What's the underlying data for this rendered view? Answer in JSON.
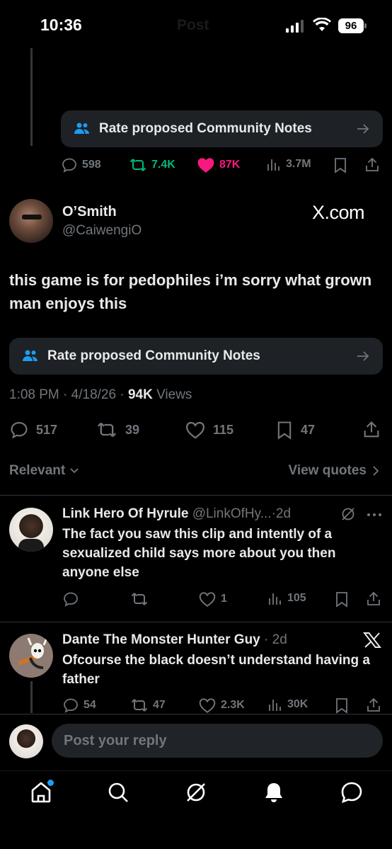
{
  "status_bar": {
    "time": "10:36",
    "battery": "96"
  },
  "header": {
    "ghost_title": "Post"
  },
  "prev_tweet": {
    "community_notes_label": "Rate proposed Community Notes",
    "replies": "598",
    "reposts": "7.4K",
    "likes": "87K",
    "views": "3.7M"
  },
  "main_tweet": {
    "display_name": "O’Smith",
    "handle": "@CaiwengiO",
    "source_logo": "X.com",
    "text": "this game is for pedophiles i’m sorry what grown man enjoys this",
    "community_notes_label": "Rate proposed Community Notes",
    "time": "1:08 PM",
    "date": "4/18/26",
    "views_count": "94K",
    "views_label": "Views",
    "replies": "517",
    "reposts": "39",
    "likes": "115",
    "bookmarks": "47"
  },
  "sort": {
    "label": "Relevant",
    "view_quotes": "View quotes"
  },
  "replies": [
    {
      "name": "Link Hero Of Hyrule",
      "handle": "@LinkOfHy...",
      "time": "2d",
      "text": "The fact you saw this clip and intently of a sexualized child says more about you then anyone else",
      "replies": "",
      "reposts": "",
      "likes": "1",
      "views": "105"
    },
    {
      "name": "Dante The Monster Hunter Guy",
      "time": "2d",
      "text": "Ofcourse the black doesn’t understand having a father",
      "replies": "54",
      "reposts": "47",
      "likes": "2.3K",
      "views": "30K"
    }
  ],
  "composer": {
    "placeholder": "Post your reply"
  },
  "colors": {
    "repost_green": "#00ba7c",
    "like_pink": "#f91880",
    "accent_blue": "#1d9bf0",
    "gray": "#71767b"
  },
  "icons": [
    "reply-icon",
    "repost-icon",
    "like-icon",
    "views-icon",
    "bookmark-icon",
    "share-icon",
    "community-notes-icon",
    "home-icon",
    "search-icon",
    "grok-icon",
    "notifications-icon",
    "messages-icon"
  ]
}
